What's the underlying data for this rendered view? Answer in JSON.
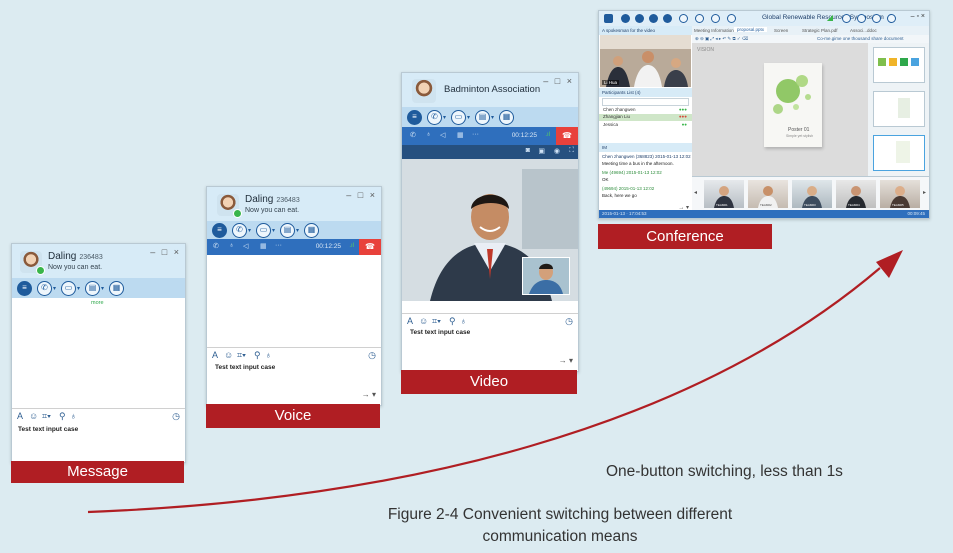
{
  "message_window": {
    "contact_name": "Daling",
    "contact_id": "236483",
    "status": "Now you can eat.",
    "window_controls": "– □ ×",
    "more_link": "more",
    "input_text": "Test text input case",
    "label": "Message"
  },
  "voice_window": {
    "contact_name": "Daling",
    "contact_id": "236483",
    "status": "Now you can eat.",
    "window_controls": "– □ ×",
    "call_time": "00:12:25",
    "input_text": "Test text input case",
    "label": "Voice"
  },
  "video_window": {
    "contact_name": "Badminton Association",
    "window_controls": "– □ ×",
    "call_time": "00:12:25",
    "input_text": "Test text input case",
    "label": "Video"
  },
  "conference_window": {
    "title": "Global Renewable Resources Symposium",
    "window_controls": "– ▫ ×",
    "video_panel_title": "A spokesman for the video",
    "speaker_tag": "Li Hua",
    "tabs": [
      "Meeting Information",
      "proposal.pptx",
      "Screen",
      "Strategic Plan.pdf",
      "Associ...ddoc"
    ],
    "share_hint": "Co-me.gime one thousand share document",
    "participants_title": "Participants List (4)",
    "participants": [
      "Chen zhangwen",
      "Zhangjian Liu",
      "Jessica"
    ],
    "chat_title": "IM",
    "chat": [
      {
        "who": "Chen zhangwen (368823)",
        "time": "2015-01-13 12:02",
        "text": "Meeting time a bus in the afternoon."
      },
      {
        "who": "Me (49694)",
        "time": "2015-01-13 12:02",
        "text": "OK"
      },
      {
        "who": "(49694)",
        "time": "2015-01-13 12:02",
        "text": "Back, here we go"
      }
    ],
    "slide_brand": "VISION",
    "poster_title": "Poster 01",
    "poster_sub": "Simple yet stylish",
    "thumb_names": [
      "TEAM01",
      "TEAM02",
      "TEAM03",
      "TEAM04",
      "TEAM05"
    ],
    "status_left": "2015-01-13 · 17:04:53",
    "status_right": "00:09:45",
    "label": "Conference"
  },
  "caption_switching": "One-button switching, less than 1s",
  "figure_caption_line1": "Figure 2-4 Convenient switching between different",
  "figure_caption_line2": "communication means",
  "colors": {
    "label_red": "#b01e23",
    "arrow_red": "#b01e23",
    "toolbar_blue": "#1f5b9c",
    "background": "#dcebf1"
  }
}
